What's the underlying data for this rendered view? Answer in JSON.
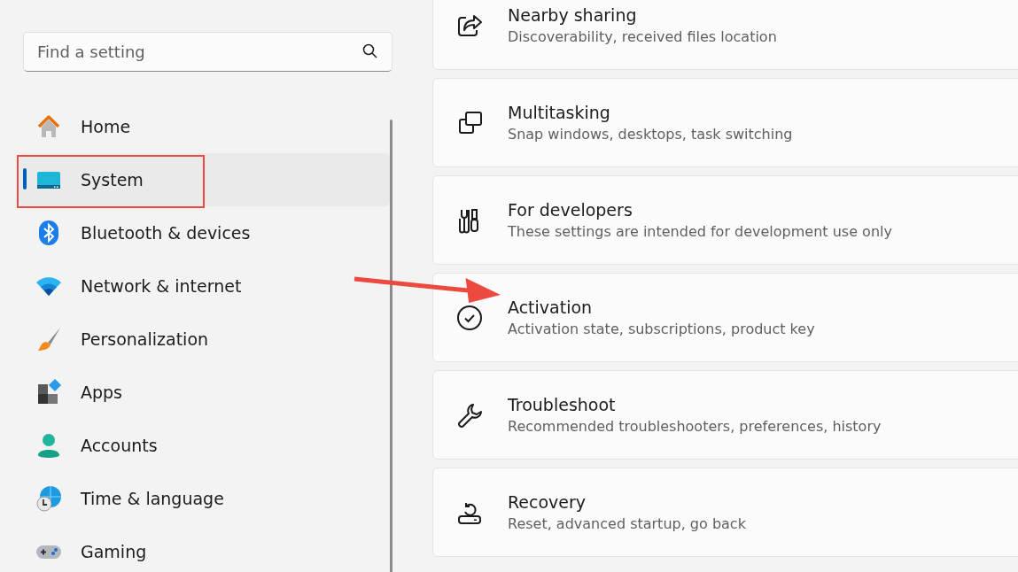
{
  "search": {
    "placeholder": "Find a setting"
  },
  "nav": [
    {
      "label": "Home",
      "kind": "home",
      "selected": false
    },
    {
      "label": "System",
      "kind": "system",
      "selected": true
    },
    {
      "label": "Bluetooth & devices",
      "kind": "bluetooth",
      "selected": false
    },
    {
      "label": "Network & internet",
      "kind": "wifi",
      "selected": false
    },
    {
      "label": "Personalization",
      "kind": "brush",
      "selected": false
    },
    {
      "label": "Apps",
      "kind": "apps",
      "selected": false
    },
    {
      "label": "Accounts",
      "kind": "person",
      "selected": false
    },
    {
      "label": "Time & language",
      "kind": "globe",
      "selected": false
    },
    {
      "label": "Gaming",
      "kind": "gamepad",
      "selected": false
    }
  ],
  "settings": [
    {
      "title": "Nearby sharing",
      "subtitle": "Discoverability, received files location",
      "kind": "share"
    },
    {
      "title": "Multitasking",
      "subtitle": "Snap windows, desktops, task switching",
      "kind": "windows"
    },
    {
      "title": "For developers",
      "subtitle": "These settings are intended for development use only",
      "kind": "tools"
    },
    {
      "title": "Activation",
      "subtitle": "Activation state, subscriptions, product key",
      "kind": "check"
    },
    {
      "title": "Troubleshoot",
      "subtitle": "Recommended troubleshooters, preferences, history",
      "kind": "wrench"
    },
    {
      "title": "Recovery",
      "subtitle": "Reset, advanced startup, go back",
      "kind": "recovery"
    }
  ]
}
